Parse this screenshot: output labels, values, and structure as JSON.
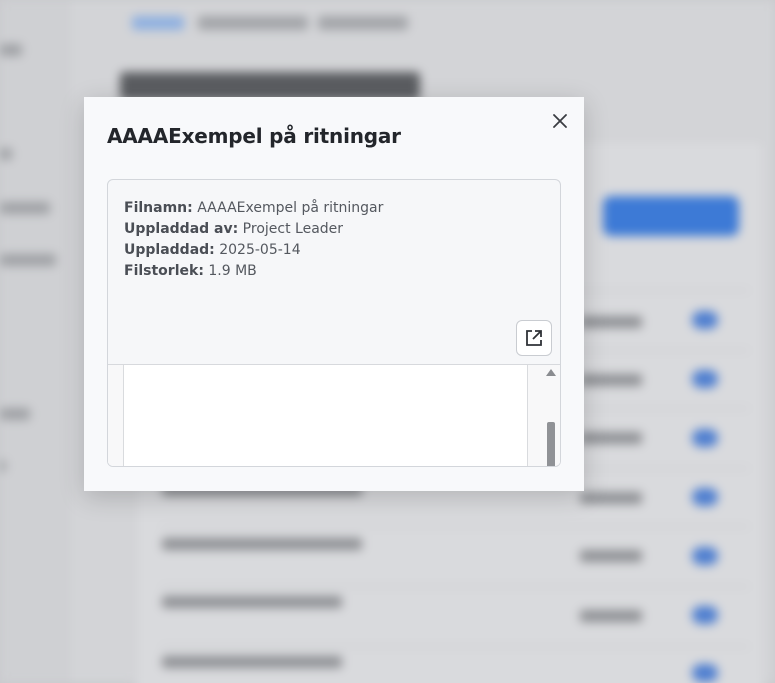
{
  "modal": {
    "title": "AAAAExempel på ritningar",
    "close_icon": "close-icon",
    "open_icon": "open-external-icon",
    "meta": [
      {
        "key": "Filnamn:",
        "value": "AAAAExempel på ritningar"
      },
      {
        "key": "Uppladdad av:",
        "value": "Project Leader"
      },
      {
        "key": "Uppladdad:",
        "value": "2025-05-14"
      },
      {
        "key": "Filstorlek:",
        "value": "1.9 MB"
      }
    ]
  },
  "colors": {
    "modal_bg": "#f8f9fb",
    "title": "#23262b",
    "text": "#54585f",
    "backdrop": "#c9cacd",
    "accent_blurred": "#3d7ad6"
  }
}
